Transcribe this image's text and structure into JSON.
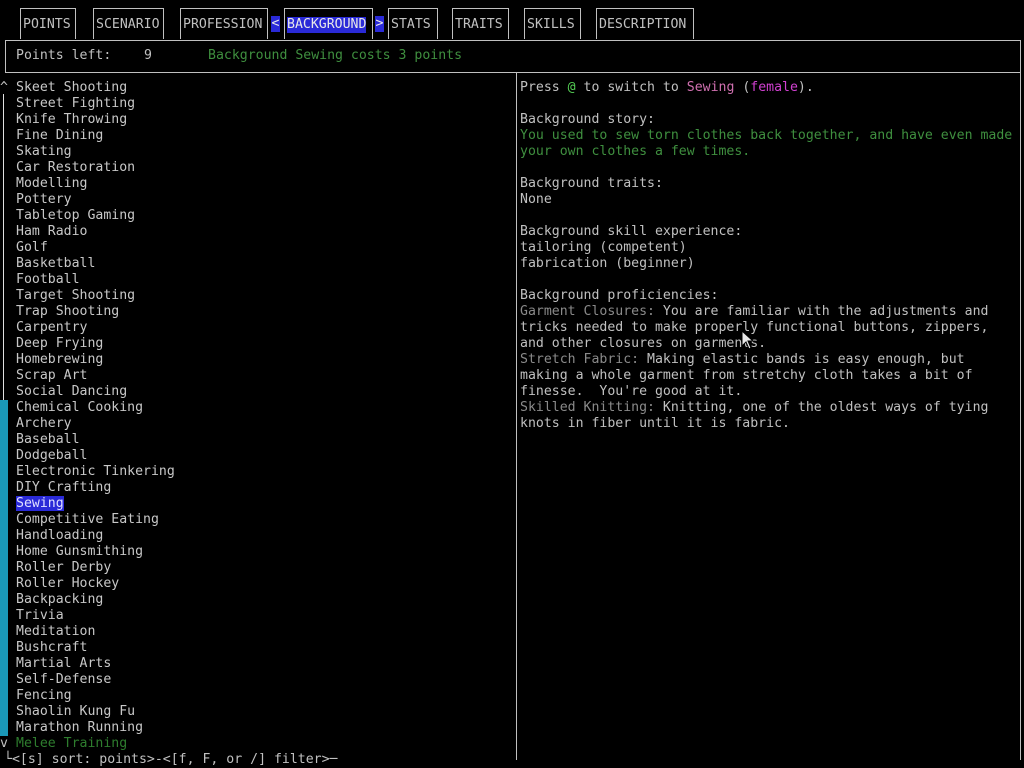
{
  "tabs": [
    {
      "label": "POINTS",
      "name": "tab-points"
    },
    {
      "label": "SCENARIO",
      "name": "tab-scenario"
    },
    {
      "label": "PROFESSION",
      "name": "tab-profession"
    },
    {
      "label": "BACKGROUND",
      "name": "tab-background",
      "active": true
    },
    {
      "label": "STATS",
      "name": "tab-stats"
    },
    {
      "label": "TRAITS",
      "name": "tab-traits"
    },
    {
      "label": "SKILLS",
      "name": "tab-skills"
    },
    {
      "label": "DESCRIPTION",
      "name": "tab-description"
    }
  ],
  "nav": {
    "prev": "<",
    "next": ">"
  },
  "points": {
    "label": "Points left:",
    "value": "9",
    "message": "Background Sewing costs 3 points"
  },
  "scroll": {
    "up": "^",
    "down": "v"
  },
  "backgrounds": [
    "Skeet Shooting",
    "Street Fighting",
    "Knife Throwing",
    "Fine Dining",
    "Skating",
    "Car Restoration",
    "Modelling",
    "Pottery",
    "Tabletop Gaming",
    "Ham Radio",
    "Golf",
    "Basketball",
    "Football",
    "Target Shooting",
    "Trap Shooting",
    "Carpentry",
    "Deep Frying",
    "Homebrewing",
    "Scrap Art",
    "Social Dancing",
    "Chemical Cooking",
    "Archery",
    "Baseball",
    "Dodgeball",
    "Electronic Tinkering",
    "DIY Crafting",
    "Sewing",
    "Competitive Eating",
    "Handloading",
    "Home Gunsmithing",
    "Roller Derby",
    "Roller Hockey",
    "Backpacking",
    "Trivia",
    "Meditation",
    "Bushcraft",
    "Martial Arts",
    "Self-Defense",
    "Fencing",
    "Shaolin Kung Fu",
    "Marathon Running",
    "Melee Training"
  ],
  "selected_index": 26,
  "dim_index": 41,
  "detail": {
    "switch": {
      "pre": "Press ",
      "key": "@",
      "mid": " to switch to ",
      "name": "Sewing",
      "open": " (",
      "gender": "female",
      "close": ")."
    },
    "story_label": "Background story:",
    "story_lines": [
      "You used to sew torn clothes back together, and have even made",
      "your own clothes a few times."
    ],
    "traits_label": "Background traits:",
    "traits_value": "None",
    "skills_label": "Background skill experience:",
    "skills": [
      "tailoring (competent)",
      "fabrication (beginner)"
    ],
    "prof_label": "Background proficiencies:",
    "proficiencies": [
      {
        "name": "Garment Closures:",
        "lines": [
          " You are familiar with the adjustments and",
          "tricks needed to make properly functional buttons, zippers,",
          "and other closures on garments."
        ]
      },
      {
        "name": "Stretch Fabric:",
        "lines": [
          " Making elastic bands is easy enough, but",
          "making a whole garment from stretchy cloth takes a bit of",
          "finesse.  You're good at it."
        ]
      },
      {
        "name": "Skilled Knitting:",
        "lines": [
          " Knitting, one of the oldest ways of tying",
          "knots in fiber until it is fabric."
        ]
      }
    ]
  },
  "footer": "└<[s] sort: points>-<[f, F, or /] filter>─",
  "colors": {
    "highlight": "#2a2ad8",
    "green": "#3f8f3f",
    "scrollbar": "#1a98b8"
  }
}
